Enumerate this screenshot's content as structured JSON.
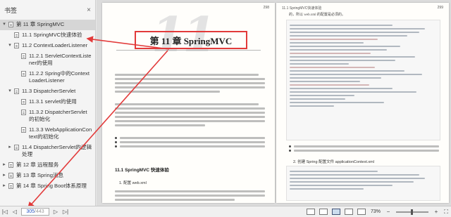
{
  "sidebar": {
    "title": "书签",
    "close_glyph": "×",
    "items": [
      {
        "label": "第 11 章 SpringMVC",
        "level": 1,
        "toggle": "▾",
        "active": true
      },
      {
        "label": "11.1 SpringMVC快速体验",
        "level": 2,
        "toggle": ""
      },
      {
        "label": "11.2 ContextLoaderListener",
        "level": 2,
        "toggle": "▾"
      },
      {
        "label": "11.2.1 ServletContextListener的使用",
        "level": 3,
        "toggle": ""
      },
      {
        "label": "11.2.2 Spring中的ContextLoaderListener",
        "level": 3,
        "toggle": ""
      },
      {
        "label": "11.3 DispatcherServlet",
        "level": 2,
        "toggle": "▾"
      },
      {
        "label": "11.3.1 servlet的使用",
        "level": 3,
        "toggle": ""
      },
      {
        "label": "11.3.2 DispatcherServlet的初始化",
        "level": 3,
        "toggle": ""
      },
      {
        "label": "11.3.3 WebApplicationContext的初始化",
        "level": 3,
        "toggle": ""
      },
      {
        "label": "11.4 DispatcherServlet的逻辑处理",
        "level": 2,
        "toggle": "▸"
      },
      {
        "label": "第 12 章 远程服务",
        "level": 1,
        "toggle": "▸"
      },
      {
        "label": "第 13 章 Spring消息",
        "level": 1,
        "toggle": "▸"
      },
      {
        "label": "第 14 章 Spring Boot体系原理",
        "level": 1,
        "toggle": "▸"
      }
    ]
  },
  "left_page": {
    "page_number": "298",
    "chapter_number_art": "11",
    "chapter_title": "第 11 章  SpringMVC",
    "section_title": "11.1  SpringMVC 快速体验",
    "sub_title": "1. 配置 web.xml"
  },
  "right_page": {
    "header": "11.1  SpringMVC快速体验",
    "page_number": "299",
    "intro": "的，所以 web.xml 的配置是必须的。",
    "sub_title": "2. 创建 Spring 配置文件 applicationContext.xml"
  },
  "toolbar": {
    "first_glyph": "|◁",
    "prev_glyph": "◁",
    "current_page": "305",
    "total_pages": "/443",
    "next_glyph": "▷",
    "last_glyph": "▷|",
    "zoom": "73%",
    "zoom_out_glyph": "−",
    "zoom_in_glyph": "+",
    "zoom_level_fraction": 0.45
  }
}
